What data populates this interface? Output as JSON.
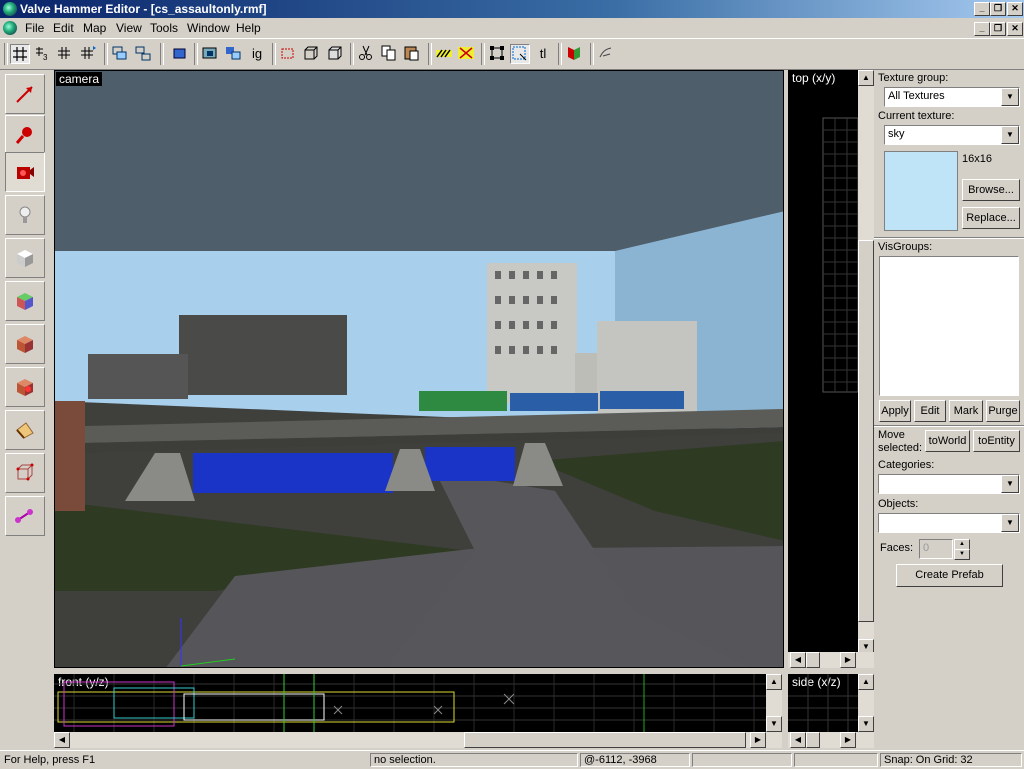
{
  "window": {
    "title": "Valve Hammer Editor - [cs_assaultonly.rmf]",
    "controls": [
      "_",
      "❐",
      "✕"
    ]
  },
  "menu": [
    "File",
    "Edit",
    "Map",
    "View",
    "Tools",
    "Window",
    "Help"
  ],
  "toolbar": {
    "ig_label": "ig",
    "tl_label": "tl"
  },
  "tools": [
    {
      "name": "selection-tool",
      "icon": "arrow-icon"
    },
    {
      "name": "magnify-tool",
      "icon": "magnify-icon"
    },
    {
      "name": "camera-tool",
      "icon": "camera-icon",
      "active": true
    },
    {
      "name": "entity-tool",
      "icon": "light-entity-icon"
    },
    {
      "name": "block-tool",
      "icon": "cube-icon"
    },
    {
      "name": "texture-app-tool",
      "icon": "texture-cube-icon"
    },
    {
      "name": "apply-texture-tool",
      "icon": "brick-icon"
    },
    {
      "name": "decal-tool",
      "icon": "decal-icon"
    },
    {
      "name": "clipping-tool",
      "icon": "clip-icon"
    },
    {
      "name": "vertex-tool",
      "icon": "vertex-icon"
    },
    {
      "name": "path-tool",
      "icon": "path-icon"
    }
  ],
  "viewports": {
    "camera": "camera",
    "top": "top (x/y)",
    "front": "front (y/z)",
    "side": "side (x/z)"
  },
  "panel": {
    "texture_group_label": "Texture group:",
    "texture_group_value": "All Textures",
    "current_texture_label": "Current texture:",
    "current_texture_value": "sky",
    "texture_size": "16x16",
    "texture_swatch_color": "#bfe3f7",
    "browse_label": "Browse...",
    "replace_label": "Replace...",
    "visgroups_label": "VisGroups:",
    "apply_label": "Apply",
    "edit_label": "Edit",
    "mark_label": "Mark",
    "purge_label": "Purge",
    "move_selected_label": "Move selected:",
    "toworld_label": "toWorld",
    "toentity_label": "toEntity",
    "categories_label": "Categories:",
    "categories_value": "",
    "objects_label": "Objects:",
    "objects_value": "",
    "faces_label": "Faces:",
    "faces_value": "0",
    "create_prefab_label": "Create Prefab"
  },
  "status": {
    "help": "For Help, press F1",
    "selection": "no selection.",
    "coords": "@-6112, -3968",
    "snap": "Snap: On Grid: 32"
  }
}
